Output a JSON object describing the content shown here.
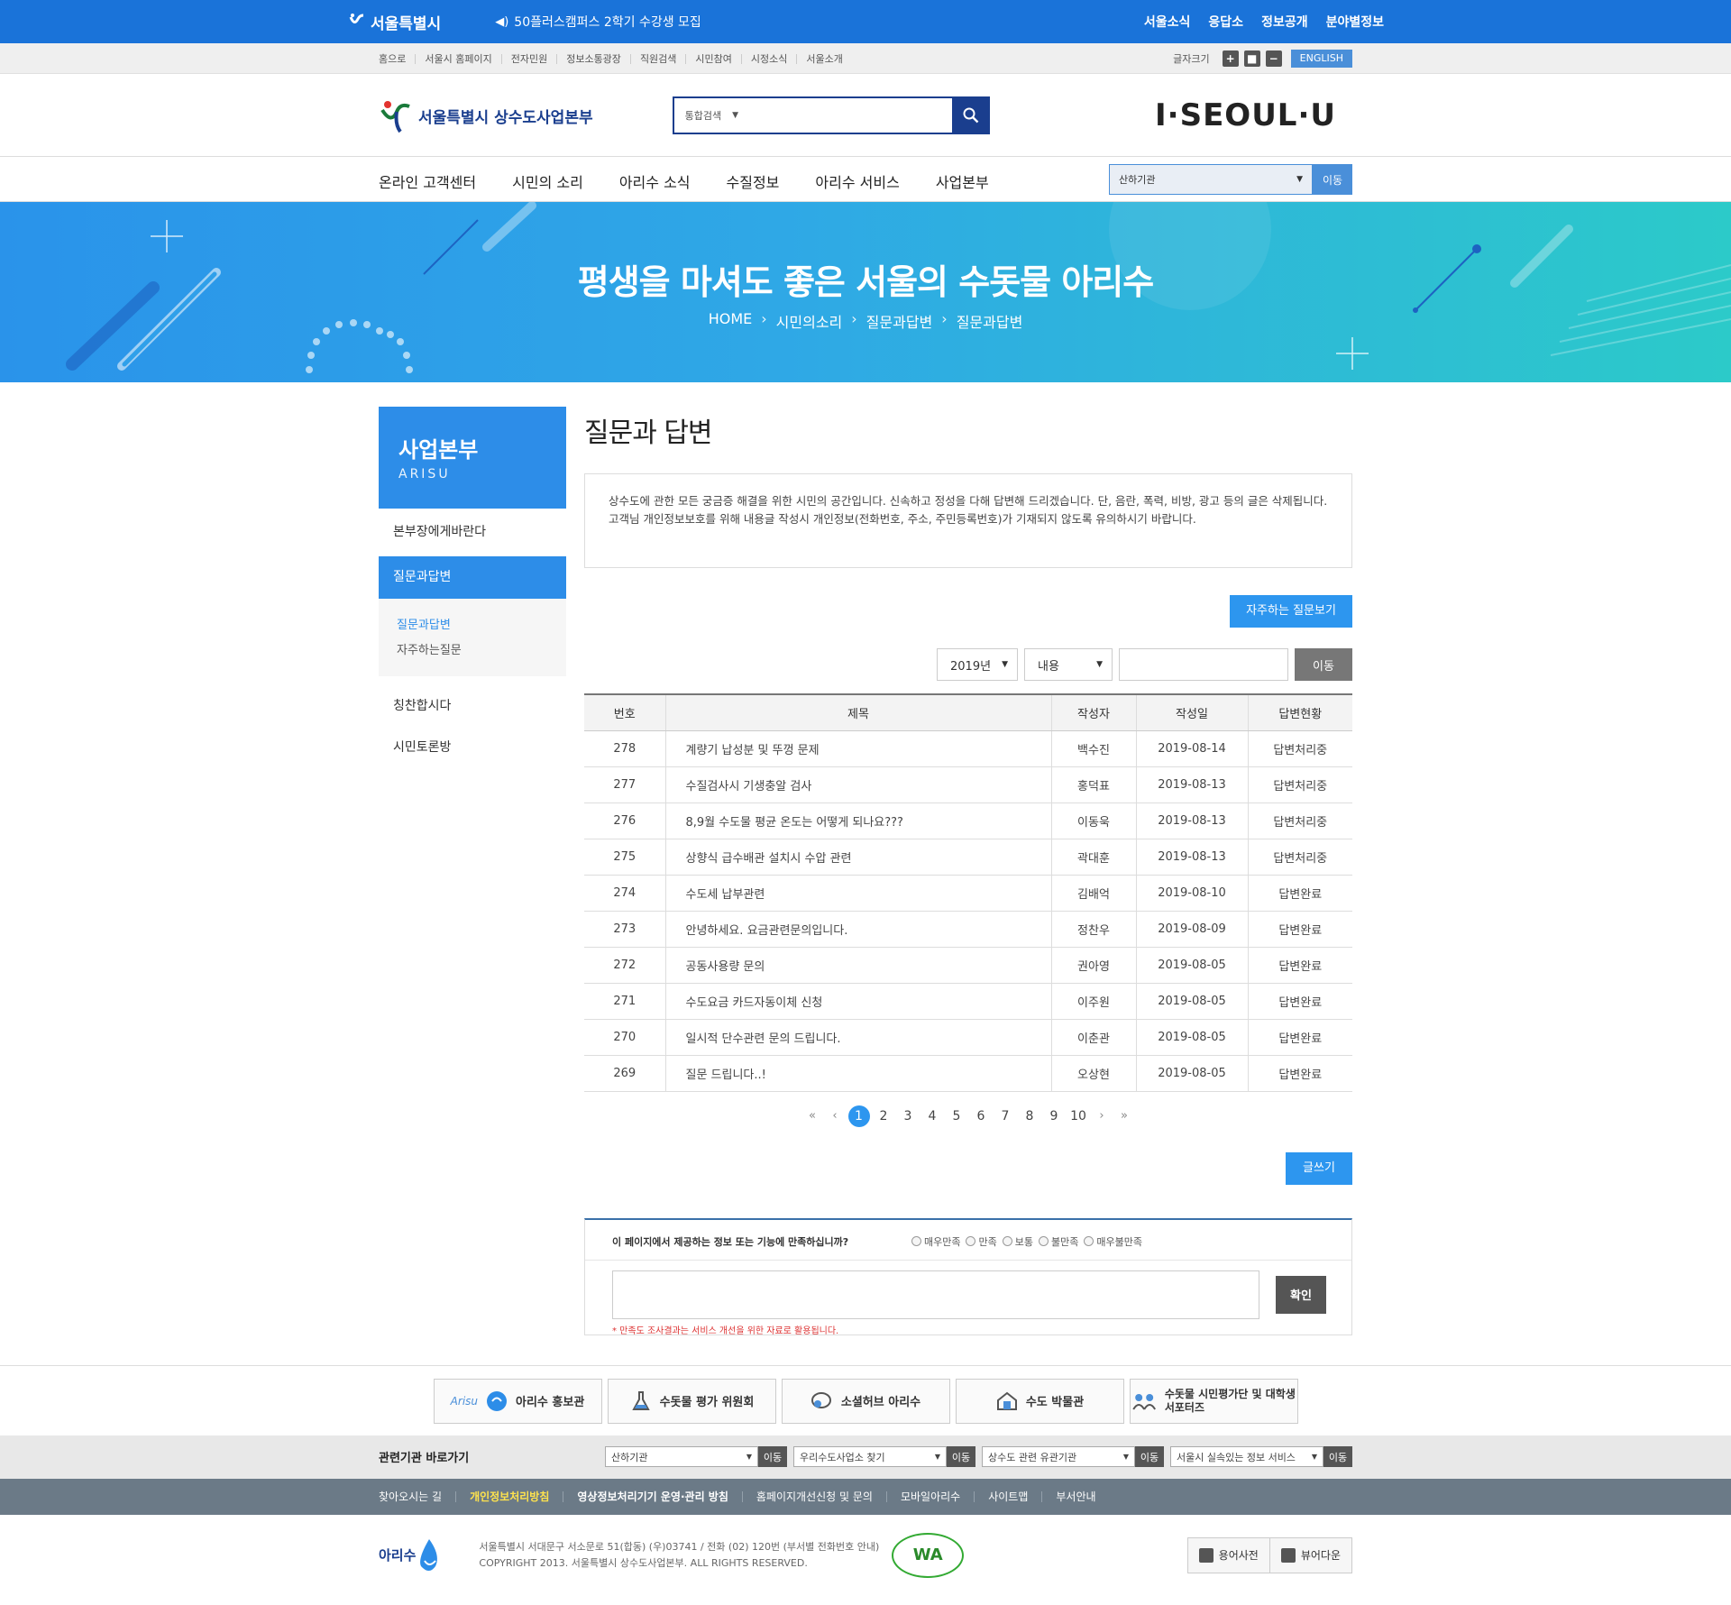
{
  "topbar": {
    "logo": "서울특별시",
    "notice": "50플러스캠퍼스 2학기 수강생 모집",
    "links": [
      "서울소식",
      "응답소",
      "정보공개",
      "분야별정보"
    ]
  },
  "util": {
    "links": [
      "홈으로",
      "서울시 홈페이지",
      "전자민원",
      "정보소통광장",
      "직원검색",
      "시민참여",
      "시정소식",
      "서울소개"
    ],
    "font_label": "글자크기",
    "font_plus": "+",
    "font_reset": "■",
    "font_minus": "−",
    "english": "ENGLISH"
  },
  "header": {
    "logo": "서울특별시 상수도사업본부",
    "search_scope": "통합검색",
    "brand": "I·SEOUL·U"
  },
  "gnb": {
    "menu": [
      "온라인 고객센터",
      "시민의 소리",
      "아리수 소식",
      "수질정보",
      "아리수 서비스",
      "사업본부"
    ],
    "org_select": "산하기관",
    "org_go": "이동"
  },
  "banner": {
    "title": "평생을 마셔도 좋은 서울의 수돗물 아리수",
    "breadcrumb": [
      "HOME",
      "시민의소리",
      "질문과답변",
      "질문과답변"
    ]
  },
  "lnb": {
    "title": "사업본부",
    "subtitle": "ARISU",
    "items": [
      "본부장에게바란다",
      "질문과답변"
    ],
    "sub": [
      "질문과답변",
      "자주하는질문"
    ],
    "items2": [
      "칭찬합시다",
      "시민토론방"
    ]
  },
  "main": {
    "title": "질문과 답변",
    "intro1": "상수도에 관한 모든 궁금증 해결을 위한 시민의 공간입니다. 신속하고 정성을 다해 답변해 드리겠습니다. 단, 음란, 폭력, 비방, 광고 등의 글은 삭제됩니다.",
    "intro2": "고객님 개인정보보호를 위해 내용글 작성시 개인정보(전화번호, 주소, 주민등록번호)가 기재되지 않도록 유의하시기 바랍니다.",
    "faq_button": "자주하는 질문보기",
    "year": "2019년",
    "field": "내용",
    "go": "이동",
    "write": "글쓰기"
  },
  "table": {
    "headers": [
      "번호",
      "제목",
      "작성자",
      "작성일",
      "답변현황"
    ],
    "rows": [
      [
        "278",
        "계량기 납성분 및 뚜껑 문제",
        "백수진",
        "2019-08-14",
        "답변처리중"
      ],
      [
        "277",
        "수질검사시 기생충알 검사",
        "홍덕표",
        "2019-08-13",
        "답변처리중"
      ],
      [
        "276",
        "8,9월 수도물 평균 온도는 어떻게 되나요???",
        "이동욱",
        "2019-08-13",
        "답변처리중"
      ],
      [
        "275",
        "상향식 급수배관 설치시 수압 관련",
        "곽대훈",
        "2019-08-13",
        "답변처리중"
      ],
      [
        "274",
        "수도세 납부관련",
        "김배억",
        "2019-08-10",
        "답변완료"
      ],
      [
        "273",
        "안녕하세요. 요금관련문의입니다.",
        "정찬우",
        "2019-08-09",
        "답변완료"
      ],
      [
        "272",
        "공동사용량 문의",
        "권아영",
        "2019-08-05",
        "답변완료"
      ],
      [
        "271",
        "수도요금 카드자동이체 신청",
        "이주원",
        "2019-08-05",
        "답변완료"
      ],
      [
        "270",
        "일시적 단수관련 문의 드립니다.",
        "이춘관",
        "2019-08-05",
        "답변완료"
      ],
      [
        "269",
        "질문 드립니다..!",
        "오상현",
        "2019-08-05",
        "답변완료"
      ]
    ]
  },
  "pager": {
    "first": "«",
    "prev": "‹",
    "next": "›",
    "last": "»",
    "pages": [
      "1",
      "2",
      "3",
      "4",
      "5",
      "6",
      "7",
      "8",
      "9",
      "10"
    ],
    "current": "1"
  },
  "survey": {
    "question": "이 페이지에서 제공하는 정보 또는 기능에 만족하십니까?",
    "options": [
      "매우만족",
      "만족",
      "보통",
      "불만족",
      "매우불만족"
    ],
    "submit": "확인",
    "note": "* 만족도 조사결과는 서비스 개선을 위한 자료로 활용됩니다."
  },
  "footer": {
    "banners": [
      "아리수 홍보관",
      "수돗물 평가 위원회",
      "소셜허브 아리수",
      "수도 박물관",
      "수돗물 시민평가단 및 대학생 서포터즈"
    ],
    "arisu_mark": "Arisu",
    "related_label": "관련기관 바로가기",
    "related": [
      "산하기관",
      "우리수도사업소 찾기",
      "상수도 관련 유관기관",
      "서울시 실속있는 정보 서비스"
    ],
    "related_go": "이동",
    "nav": [
      "찾아오시는 길",
      "개인정보처리방침",
      "영상정보처리기기 운영·관리 방침",
      "홈페이지개선신청 및 문의",
      "모바일아리수",
      "사이트맵",
      "부서안내"
    ],
    "logo": "아리수",
    "address": "서울특별시 서대문구 서소문로 51(합동) (우)03741 / 전화 (02) 120번 (부서별 전화번호 안내)",
    "copyright": "COPYRIGHT 2013. 서울특별시 상수도사업본부. ALL RIGHTS RESERVED.",
    "wa": "WA",
    "dict": "용어사전",
    "viewer": "뷰어다운"
  },
  "colors": {
    "primary": "#2d8de8",
    "topbar": "#1a73d9",
    "navy": "#1a3e8e"
  }
}
